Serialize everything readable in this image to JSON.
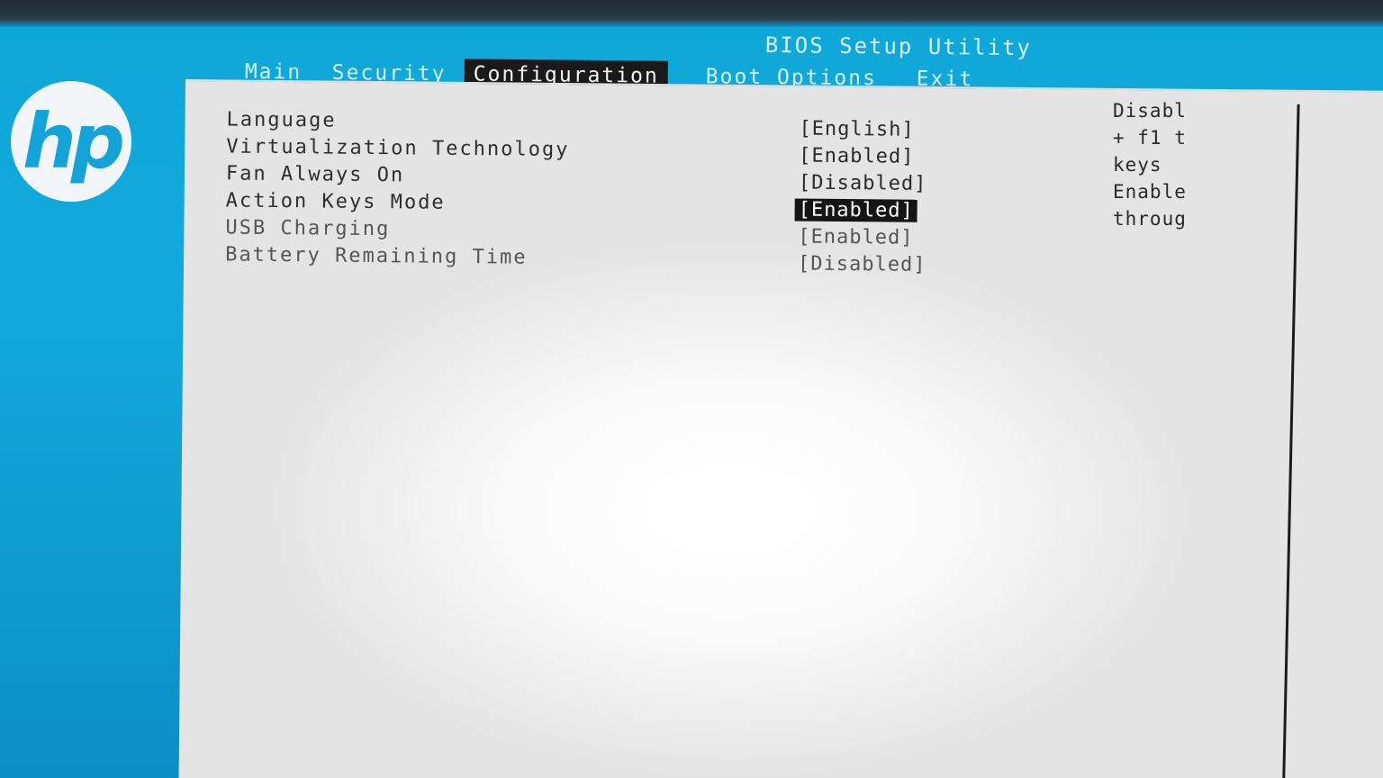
{
  "header": {
    "title": "BIOS Setup Utility"
  },
  "brand": {
    "logo_text": "hp",
    "color": "#14a3d8"
  },
  "menu": {
    "tabs": [
      {
        "label": "Main",
        "active": false
      },
      {
        "label": "Security",
        "active": false
      },
      {
        "label": "Configuration",
        "active": true
      },
      {
        "label": "Boot Options",
        "active": false
      },
      {
        "label": "Exit",
        "active": false
      }
    ]
  },
  "settings": [
    {
      "label": "Language",
      "value": "[English]"
    },
    {
      "label": "Virtualization Technology",
      "value": "[Enabled]"
    },
    {
      "label": "Fan Always On",
      "value": "[Disabled]"
    },
    {
      "label": "Action Keys Mode",
      "value": "[Enabled]",
      "selected": true
    },
    {
      "label": "USB Charging",
      "value": "[Enabled]"
    },
    {
      "label": "Battery Remaining Time",
      "value": "[Disabled]"
    }
  ],
  "help": {
    "lines": [
      "Disabl",
      "+ f1 t",
      "keys",
      "Enable",
      "throug"
    ]
  }
}
